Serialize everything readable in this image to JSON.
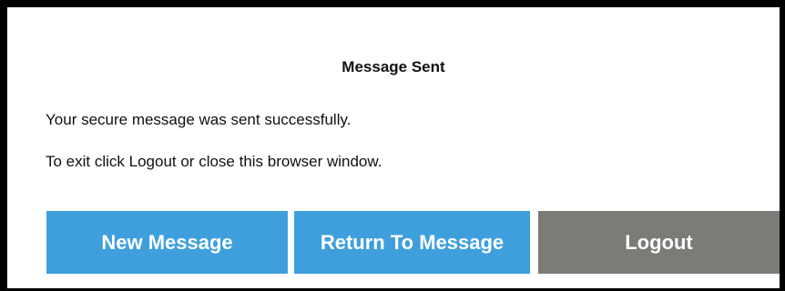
{
  "dialog": {
    "title": "Message Sent",
    "message_line1": "Your secure message was sent successfully.",
    "message_line2": "To exit click Logout or close this browser window."
  },
  "buttons": {
    "new_message": "New Message",
    "return_to_message": "Return To Message",
    "logout": "Logout"
  },
  "colors": {
    "primary_button": "#3f9fdc",
    "secondary_button": "#7c7b78",
    "frame_border": "#000000"
  }
}
